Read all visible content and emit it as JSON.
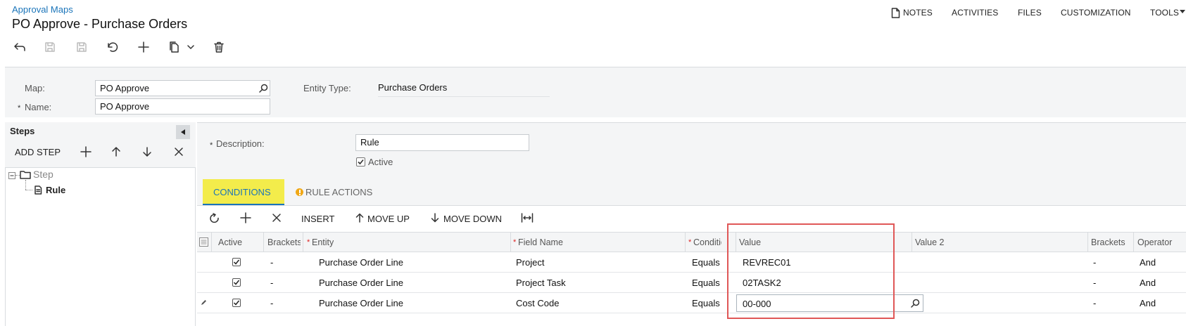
{
  "header": {
    "breadcrumb": "Approval Maps",
    "title": "PO Approve - Purchase Orders",
    "nav": {
      "notes": "NOTES",
      "activities": "ACTIVITIES",
      "files": "FILES",
      "customization": "CUSTOMIZATION",
      "tools": "TOOLS"
    }
  },
  "form": {
    "map_label": "Map:",
    "map_value": "PO Approve",
    "name_label": "Name:",
    "name_value": "PO Approve",
    "entity_type_label": "Entity Type:",
    "entity_type_value": "Purchase Orders",
    "required_mark": "*"
  },
  "steps": {
    "title": "Steps",
    "add_step": "ADD STEP",
    "tree": {
      "step": "Step",
      "rule": "Rule"
    }
  },
  "rule": {
    "description_label": "Description:",
    "description_value": "Rule",
    "active_label": "Active"
  },
  "tabs": {
    "conditions": "CONDITIONS",
    "rule_actions": "RULE ACTIONS"
  },
  "grid_toolbar": {
    "insert": "INSERT",
    "move_up": "MOVE UP",
    "move_down": "MOVE DOWN"
  },
  "columns": {
    "active": "Active",
    "brackets": "Brackets",
    "entity": "Entity",
    "field_name": "Field Name",
    "condition": "Condition",
    "value": "Value",
    "value2": "Value 2",
    "brackets2": "Brackets",
    "operator": "Operator"
  },
  "rows": [
    {
      "brackets": "-",
      "entity": "Purchase Order Line",
      "field": "Project",
      "condition": "Equals",
      "value": "REVREC01",
      "brackets2": "-",
      "operator": "And"
    },
    {
      "brackets": "-",
      "entity": "Purchase Order Line",
      "field": "Project Task",
      "condition": "Equals",
      "value": "02TASK2",
      "brackets2": "-",
      "operator": "And"
    },
    {
      "brackets": "-",
      "entity": "Purchase Order Line",
      "field": "Cost Code",
      "condition": "Equals",
      "value": "00-000",
      "brackets2": "-",
      "operator": "And"
    }
  ],
  "colors": {
    "link": "#1a74b9",
    "tab_highlight": "#f3ec4b",
    "annotation_box": "#e05757"
  }
}
